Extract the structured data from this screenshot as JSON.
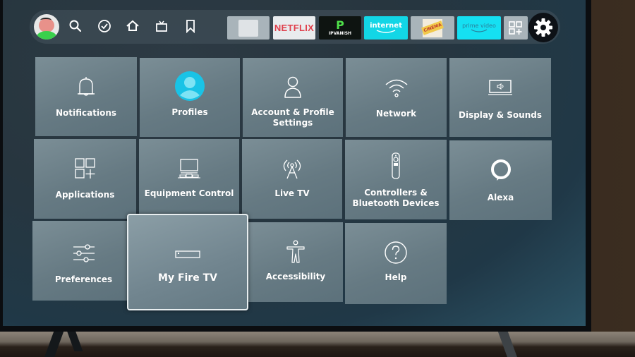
{
  "nav": {
    "profile_avatar": "avatar-cartoon",
    "icons": [
      "search-icon",
      "check-circle-icon",
      "home-icon",
      "live-tv-icon",
      "bookmark-icon"
    ],
    "apps": [
      {
        "name": "unknown-app",
        "label": "",
        "bg": "#a9b4ba"
      },
      {
        "name": "netflix",
        "label": "NETFLIX",
        "bg": "#e9ecee",
        "color": "#e0414d"
      },
      {
        "name": "ipvanish",
        "label": "IPVANISH",
        "bg": "#0e1411",
        "color": "#4fe04a"
      },
      {
        "name": "internet",
        "label": "internet",
        "bg": "#12d6e6",
        "color": "#ffffff"
      },
      {
        "name": "cinema",
        "label": "CINEMA",
        "bg": "#a9b4ba",
        "color": "#c0392b"
      },
      {
        "name": "prime-video",
        "label": "prime video",
        "bg": "#15e0f2",
        "color": "#2a7e9a"
      }
    ],
    "all_apps_icon": "apps-grid-plus-icon",
    "settings_icon": "gear-icon"
  },
  "settings": {
    "tiles": [
      {
        "id": "notifications",
        "label": "Notifications",
        "icon": "bell-icon"
      },
      {
        "id": "profiles",
        "label": "Profiles",
        "icon": "profile-avatar-icon"
      },
      {
        "id": "account",
        "label": "Account & Profile Settings",
        "icon": "person-icon"
      },
      {
        "id": "network",
        "label": "Network",
        "icon": "wifi-icon"
      },
      {
        "id": "display",
        "label": "Display & Sounds",
        "icon": "display-speaker-icon"
      },
      {
        "id": "applications",
        "label": "Applications",
        "icon": "apps-grid-plus-icon"
      },
      {
        "id": "equipment",
        "label": "Equipment Control",
        "icon": "tv-equipment-icon"
      },
      {
        "id": "livetv",
        "label": "Live TV",
        "icon": "antenna-icon"
      },
      {
        "id": "controllers",
        "label": "Controllers & Bluetooth Devices",
        "icon": "remote-icon"
      },
      {
        "id": "alexa",
        "label": "Alexa",
        "icon": "alexa-ring-icon"
      },
      {
        "id": "preferences",
        "label": "Preferences",
        "icon": "sliders-icon"
      },
      {
        "id": "myfiretv",
        "label": "My Fire TV",
        "icon": "fire-tv-device-icon",
        "focused": true
      },
      {
        "id": "accessibility",
        "label": "Accessibility",
        "icon": "accessibility-icon"
      },
      {
        "id": "help",
        "label": "Help",
        "icon": "question-circle-icon"
      }
    ]
  },
  "colors": {
    "accent": "#19c3e6",
    "tile": "#6c8089",
    "focus_border": "#e8eef0"
  }
}
